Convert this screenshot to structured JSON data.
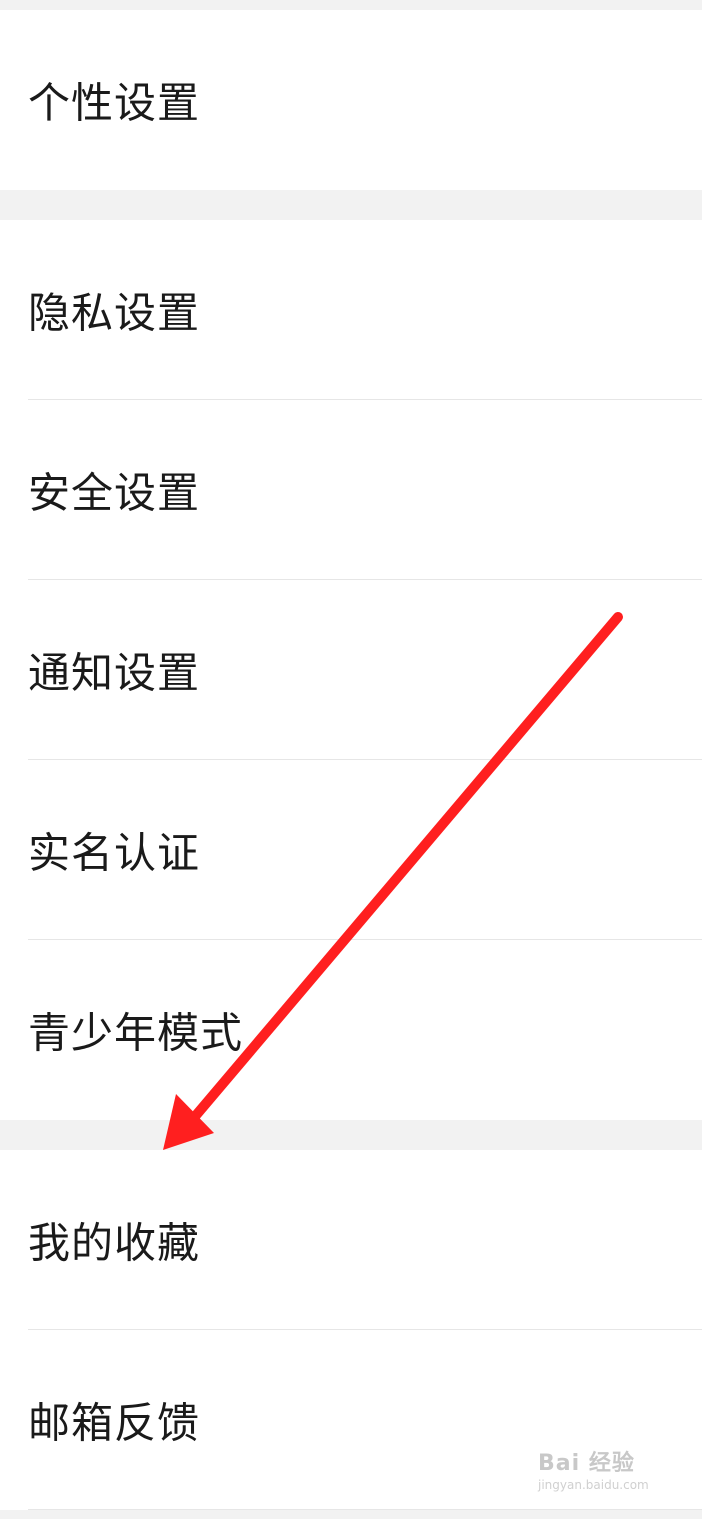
{
  "groups": [
    {
      "items": [
        {
          "label": "个性设置"
        }
      ]
    },
    {
      "items": [
        {
          "label": "隐私设置"
        },
        {
          "label": "安全设置"
        },
        {
          "label": "通知设置"
        },
        {
          "label": "实名认证"
        },
        {
          "label": "青少年模式"
        }
      ]
    },
    {
      "items": [
        {
          "label": "我的收藏"
        },
        {
          "label": "邮箱反馈"
        }
      ]
    }
  ],
  "annotation": {
    "type": "arrow",
    "color": "#ff1f1f",
    "points_to": "我的收藏"
  },
  "watermark": {
    "text": "Bai 经验",
    "url": "jingyan.baidu.com"
  },
  "colors": {
    "background": "#f2f2f2",
    "row_background": "#ffffff",
    "text": "#1a1a1a",
    "divider": "#e6e6e6"
  }
}
